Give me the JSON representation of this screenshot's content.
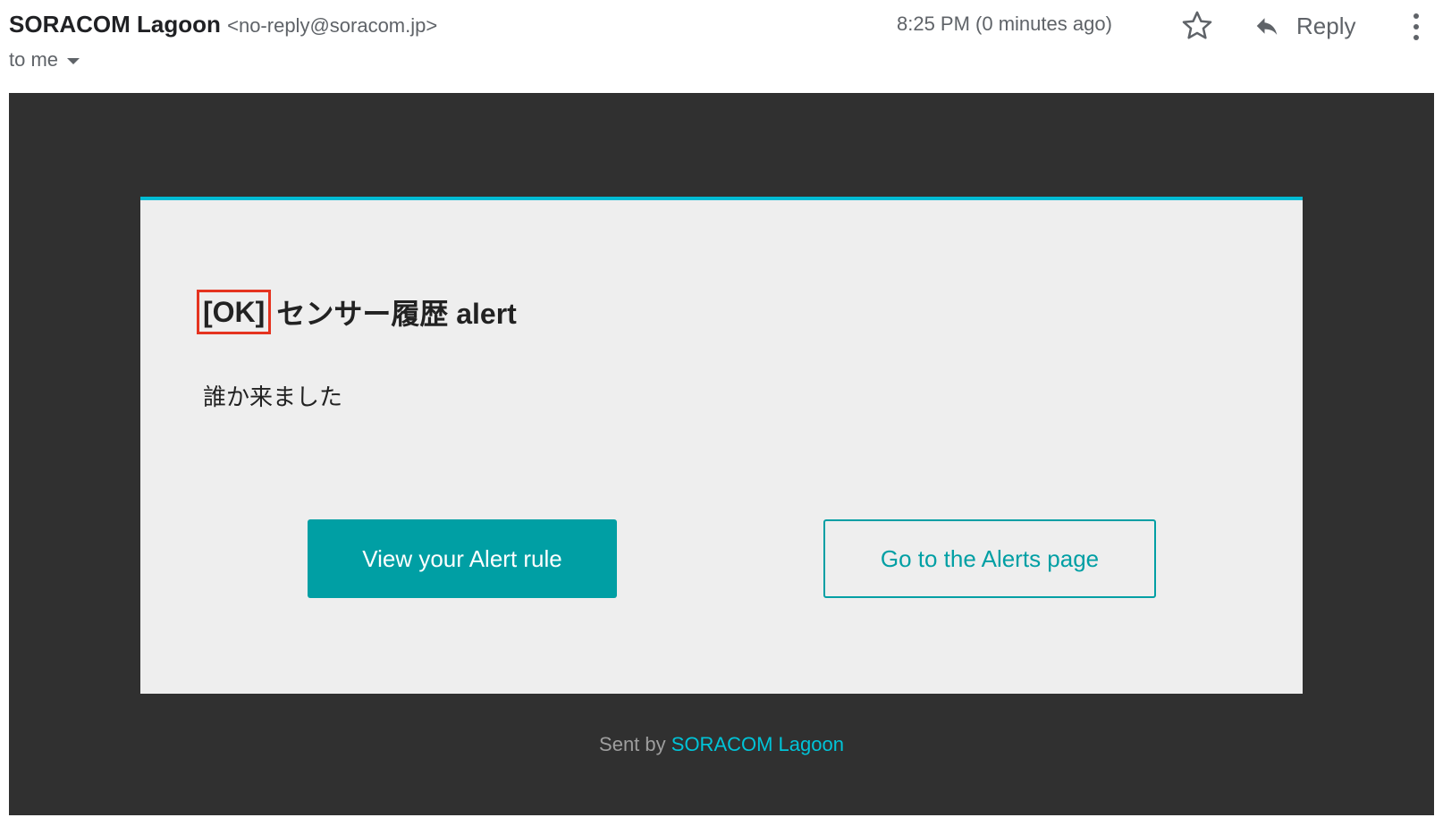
{
  "header": {
    "sender_name": "SORACOM Lagoon",
    "sender_email": "<no-reply@soracom.jp>",
    "recipient": "to me",
    "timestamp": "8:25 PM (0 minutes ago)",
    "reply_label": "Reply",
    "icons": {
      "star": "star-icon",
      "reply": "reply-arrow-icon",
      "more": "more-vertical-icon",
      "caret": "chevron-down-icon"
    }
  },
  "email_body": {
    "alert_status": "[OK]",
    "alert_title": "センサー履歴 alert",
    "alert_message": "誰か来ました",
    "primary_button": "View your Alert rule",
    "secondary_button": "Go to the Alerts page",
    "footer_prefix": "Sent by",
    "footer_link": "SORACOM Lagoon"
  },
  "colors": {
    "accent": "#009fa4",
    "card_top_border": "#00bcd4",
    "highlight_box": "#e5331f",
    "email_background": "#303030",
    "card_background": "#eeeeee",
    "footer_link": "#00c4d8"
  }
}
